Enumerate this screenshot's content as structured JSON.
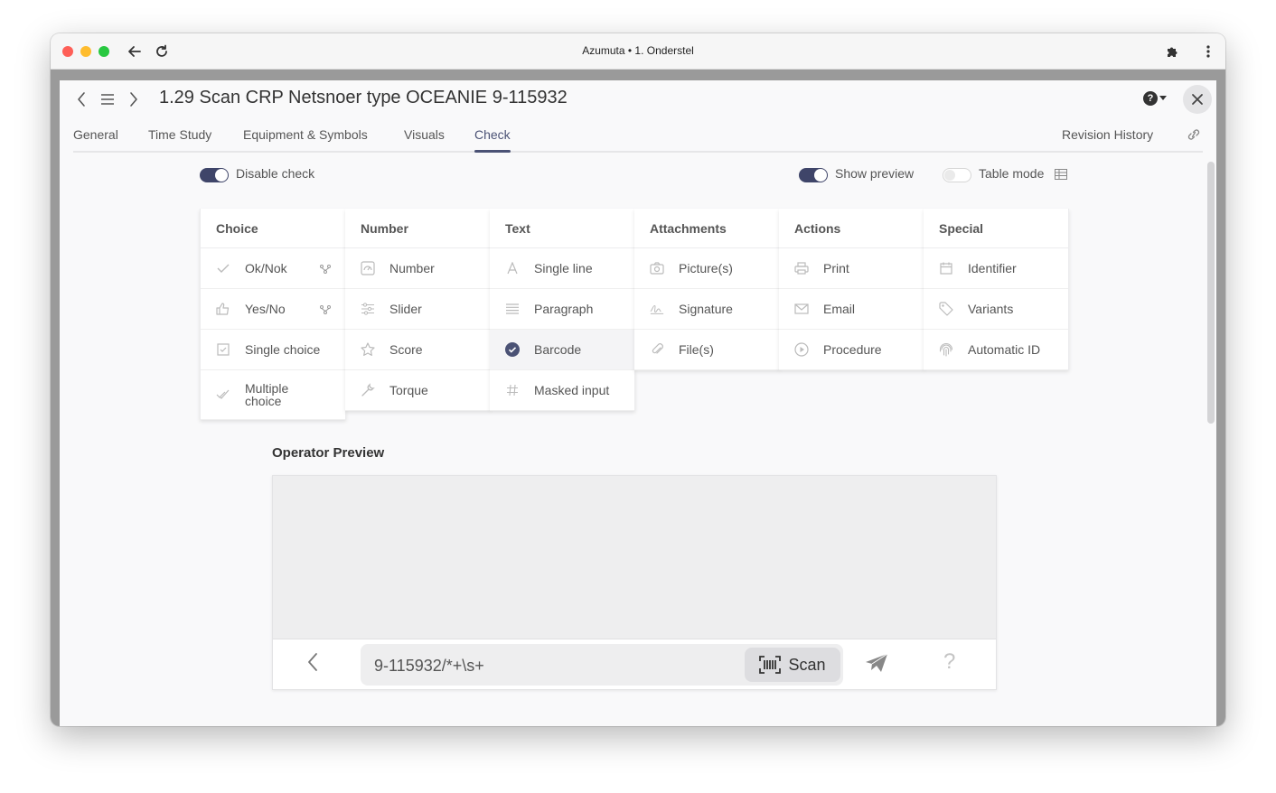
{
  "window": {
    "title": "Azumuta • 1. Onderstel"
  },
  "header": {
    "title": "1.29  Scan CRP Netsnoer type OCEANIE 9-115932"
  },
  "tabs": [
    "General",
    "Time Study",
    "Equipment & Symbols",
    "Visuals",
    "Check"
  ],
  "active_tab": "Check",
  "revision_history": "Revision History",
  "toggles": {
    "disable_check": {
      "label": "Disable check",
      "on": true
    },
    "show_preview": {
      "label": "Show preview",
      "on": true
    },
    "table_mode": {
      "label": "Table mode",
      "on": false
    }
  },
  "categories": [
    {
      "title": "Choice",
      "items": [
        {
          "label": "Ok/Nok",
          "icon": "check-icon",
          "extra": "branch-icon"
        },
        {
          "label": "Yes/No",
          "icon": "thumbs-up-icon",
          "extra": "branch-icon"
        },
        {
          "label": "Single choice",
          "icon": "checkbox-icon"
        },
        {
          "label": "Multiple choice",
          "icon": "double-check-icon"
        }
      ]
    },
    {
      "title": "Number",
      "items": [
        {
          "label": "Number",
          "icon": "gauge-icon"
        },
        {
          "label": "Slider",
          "icon": "sliders-icon"
        },
        {
          "label": "Score",
          "icon": "star-icon"
        },
        {
          "label": "Torque",
          "icon": "wrench-icon"
        }
      ]
    },
    {
      "title": "Text",
      "items": [
        {
          "label": "Single line",
          "icon": "font-icon"
        },
        {
          "label": "Paragraph",
          "icon": "paragraph-icon"
        },
        {
          "label": "Barcode",
          "icon": "selected-check-icon",
          "selected": true
        },
        {
          "label": "Masked input",
          "icon": "hash-icon"
        }
      ]
    },
    {
      "title": "Attachments",
      "items": [
        {
          "label": "Picture(s)",
          "icon": "camera-icon"
        },
        {
          "label": "Signature",
          "icon": "signature-icon"
        },
        {
          "label": "File(s)",
          "icon": "paperclip-icon"
        }
      ]
    },
    {
      "title": "Actions",
      "items": [
        {
          "label": "Print",
          "icon": "printer-icon"
        },
        {
          "label": "Email",
          "icon": "envelope-icon"
        },
        {
          "label": "Procedure",
          "icon": "play-icon"
        }
      ]
    },
    {
      "title": "Special",
      "items": [
        {
          "label": "Identifier",
          "icon": "calendar-icon"
        },
        {
          "label": "Variants",
          "icon": "tag-icon"
        },
        {
          "label": "Automatic ID",
          "icon": "fingerprint-icon"
        }
      ]
    }
  ],
  "operator_preview": {
    "title": "Operator Preview",
    "input_value": "9-115932/*+\\s+",
    "scan_label": "Scan"
  },
  "colors": {
    "accent": "#4b5275",
    "toggle_on": "#3f4569",
    "selected_check": "#4b5275"
  }
}
